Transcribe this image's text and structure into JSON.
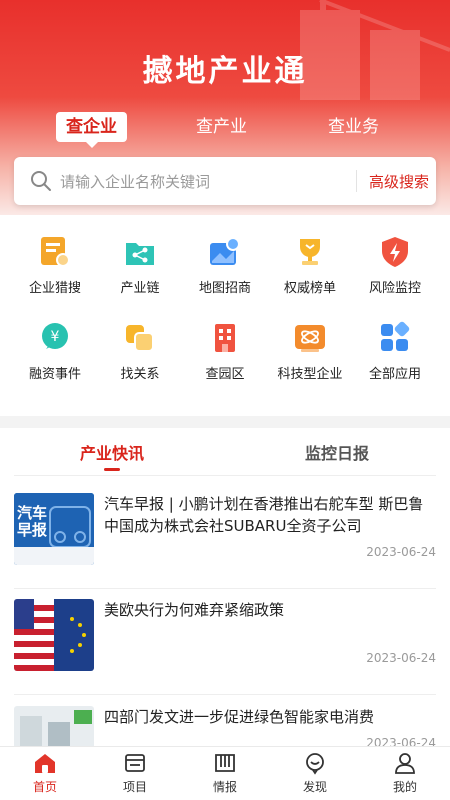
{
  "header": {
    "title": "撼地产业通"
  },
  "tabs": [
    {
      "label": "查企业"
    },
    {
      "label": "查产业"
    },
    {
      "label": "查业务"
    }
  ],
  "search": {
    "placeholder": "请输入企业名称关键词",
    "advanced": "高级搜索"
  },
  "features": [
    {
      "label": "企业猎搜",
      "icon": "company-search-icon"
    },
    {
      "label": "产业链",
      "icon": "share-chain-icon"
    },
    {
      "label": "地图招商",
      "icon": "map-pin-icon"
    },
    {
      "label": "权威榜单",
      "icon": "trophy-icon"
    },
    {
      "label": "风险监控",
      "icon": "shield-lightning-icon"
    },
    {
      "label": "融资事件",
      "icon": "yen-bubble-icon"
    },
    {
      "label": "找关系",
      "icon": "relation-icon"
    },
    {
      "label": "查园区",
      "icon": "building-icon"
    },
    {
      "label": "科技型企业",
      "icon": "atom-icon"
    },
    {
      "label": "全部应用",
      "icon": "apps-grid-icon"
    }
  ],
  "news_tabs": [
    {
      "label": "产业快讯"
    },
    {
      "label": "监控日报"
    }
  ],
  "news": [
    {
      "title": "汽车早报 | 小鹏计划在香港推出右舵车型 斯巴鲁中国成为株式会社SUBARU全资子公司",
      "date": "2023-06-24",
      "thumb_text": "汽车\n早报"
    },
    {
      "title": "美欧央行为何难弃紧缩政策",
      "date": "2023-06-24"
    },
    {
      "title": "四部门发文进一步促进绿色智能家电消费",
      "date": "2023-06-24"
    }
  ],
  "bottom_nav": [
    {
      "label": "首页",
      "icon": "home-icon"
    },
    {
      "label": "项目",
      "icon": "project-icon"
    },
    {
      "label": "情报",
      "icon": "intel-book-icon"
    },
    {
      "label": "发现",
      "icon": "discover-icon"
    },
    {
      "label": "我的",
      "icon": "user-icon"
    }
  ],
  "colors": {
    "brand": "#d9251c",
    "muted": "#9a9a9a"
  }
}
